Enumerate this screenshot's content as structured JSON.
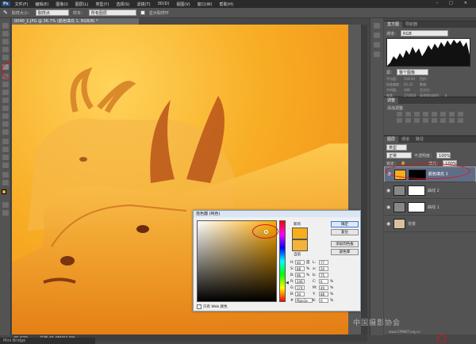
{
  "app": {
    "logo": "Ps"
  },
  "menu": [
    "文件(F)",
    "编辑(E)",
    "图像(I)",
    "图层(L)",
    "类型(Y)",
    "选择(S)",
    "滤镜(T)",
    "3D(D)",
    "视图(V)",
    "窗口(W)",
    "帮助(H)"
  ],
  "options": {
    "sample_size_label": "取样大小：",
    "sample_size_value": "取样点",
    "sample_label": "样本：",
    "sample_value": "所有图层",
    "ring_label": "显示取样环"
  },
  "doc_tab": "0040_1.JPG @ 36.7% (颜色填充 1, RGB/8) *",
  "status": {
    "zoom": "36.67%",
    "doc": "文档:45.0M/92.6M"
  },
  "mini_bridge": "Mini Bridge",
  "histogram": {
    "tabs": [
      "直方图",
      "导航器"
    ],
    "channel_label": "通道：",
    "channel_value": "RGB",
    "source_label": "源：",
    "source_value": "整个图像",
    "stats": {
      "mean_label": "平均值：",
      "mean": "159.94",
      "std_label": "标准偏差：",
      "std": "62.31",
      "median_label": "中间值：",
      "median": "168",
      "pixels_label": "像素：",
      "pixels": "270000",
      "level_label": "色阶：",
      "count_label": "数量：",
      "percent_label": "百分位：",
      "cache_label": "高速缓存级别：",
      "cache": "4"
    }
  },
  "adjustments": {
    "tab": "调整",
    "add_label": "添加调整"
  },
  "layers": {
    "tabs": [
      "图层",
      "通道",
      "路径"
    ],
    "kind_value": "类型",
    "blend_value": "正常",
    "opacity_label": "不透明度：",
    "opacity_value": "100%",
    "lock_label": "锁定：",
    "fill_label": "填充：",
    "fill_value": "100%",
    "rows": [
      {
        "name": "颜色填充 1"
      },
      {
        "name": "曲线 2"
      },
      {
        "name": "曲线 1"
      },
      {
        "name": "背景"
      }
    ]
  },
  "color_picker": {
    "title": "拾色器 (纯色)",
    "new_label": "新的",
    "current_label": "当前",
    "buttons": [
      "确定",
      "复位",
      "添加到色板",
      "颜色库"
    ],
    "web_only_label": "只有 Web 颜色",
    "fields": {
      "H": "40",
      "H_unit": "度",
      "S": "88",
      "S_unit": "%",
      "B": "96",
      "B_unit": "%",
      "R": "246",
      "G": "174",
      "Bv": "30",
      "L": "77",
      "a": "20",
      "b": "75",
      "C": "6",
      "M": "40",
      "Y": "88",
      "K": "0",
      "hex_label": "#",
      "hex": "f6ae1e"
    }
  },
  "watermark": {
    "cn": "中国摄影协会",
    "en": "www.CPANET.org.cn"
  },
  "colors": {
    "new_color": "#f6ae1e",
    "current_color": "#f3b33a",
    "selection_ring": "#e0141c"
  }
}
